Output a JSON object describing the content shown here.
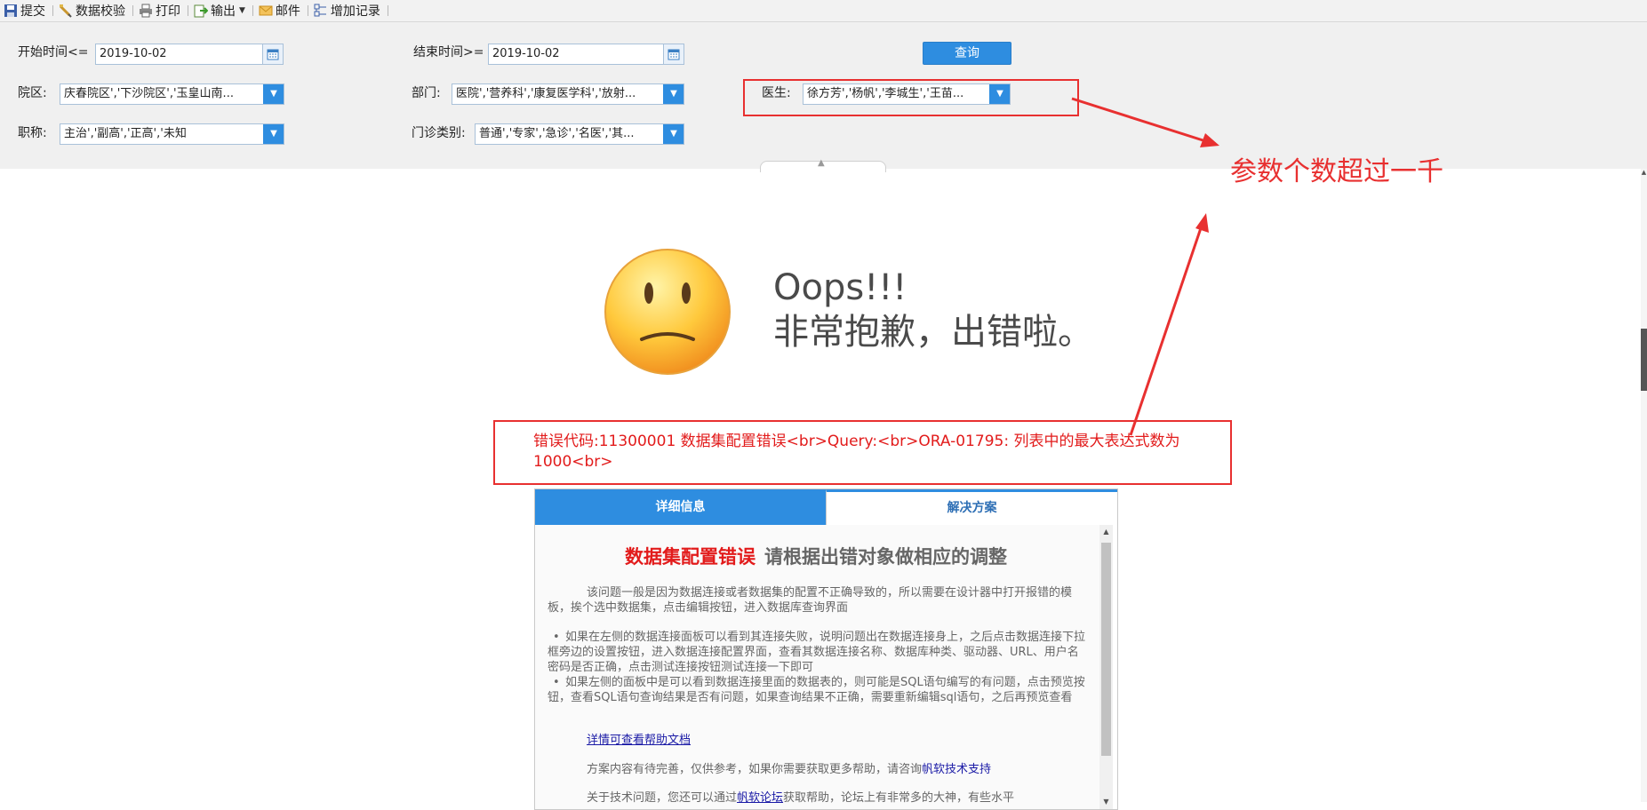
{
  "toolbar": {
    "items": [
      {
        "label": "提交",
        "icon": "save-icon"
      },
      {
        "label": "数据校验",
        "icon": "validate-icon"
      },
      {
        "label": "打印",
        "icon": "print-icon"
      },
      {
        "label": "输出",
        "icon": "export-icon"
      },
      {
        "label": "邮件",
        "icon": "mail-icon"
      },
      {
        "label": "增加记录",
        "icon": "add-record-icon"
      }
    ]
  },
  "params": {
    "start_time_label": "开始时间<=",
    "start_time_value": "2019-10-02",
    "end_time_label": "结束时间>=",
    "end_time_value": "2019-10-02",
    "query_label": "查询",
    "campus_label": "院区:",
    "campus_value": "庆春院区','下沙院区','玉皇山南...",
    "dept_label": "部门:",
    "dept_value": "医院','营养科','康复医学科','放射...",
    "doctor_label": "医生:",
    "doctor_value": "徐方芳','杨帆','李城生','王苗...",
    "title_label": "职称:",
    "title_value": "主治','副高','正高','未知",
    "clinic_type_label": "门诊类别:",
    "clinic_type_value": "普通','专家','急诊','名医','其..."
  },
  "annotation": {
    "text": "参数个数超过一千",
    "color": "#e83030"
  },
  "error": {
    "oops": "Oops!!!",
    "sorry": "非常抱歉，出错啦。",
    "message": "错误代码:11300001 数据集配置错误<br>Query:<br>ORA-01795: 列表中的最大表达式数为 1000<br>"
  },
  "panel": {
    "tabs": [
      {
        "label": "详细信息",
        "active": true
      },
      {
        "label": "解决方案",
        "active": false
      }
    ],
    "heading_red": "数据集配置错误",
    "heading_gray": "请根据出错对象做相应的调整",
    "intro": "该问题一般是因为数据连接或者数据集的配置不正确导致的，所以需要在设计器中打开报错的模板，挨个选中数据集，点击编辑按钮，进入数据库查询界面",
    "bullets": [
      "如果在左侧的数据连接面板可以看到其连接失败，说明问题出在数据连接身上，之后点击数据连接下拉框旁边的设置按钮，进入数据连接配置界面，查看其数据连接名称、数据库种类、驱动器、URL、用户名密码是否正确，点击测试连接按钮测试连接一下即可",
      "如果左侧的面板中是可以看到数据连接里面的数据表的，则可能是SQL语句编写的有问题，点击预览按钮，查看SQL语句查询结果是否有问题，如果查询结果不正确，需要重新编辑sql语句，之后再预览查看"
    ],
    "help_link": "详情可查看帮助文档",
    "support_prefix": "方案内容有待完善，仅供参考，如果你需要获取更多帮助，请咨询",
    "support_link": "帆软技术支持",
    "forum_prefix": "关于技术问题，您还可以通过",
    "forum_link": "帆软论坛",
    "forum_suffix": "获取帮助，论坛上有非常多的大神，有些水平"
  }
}
